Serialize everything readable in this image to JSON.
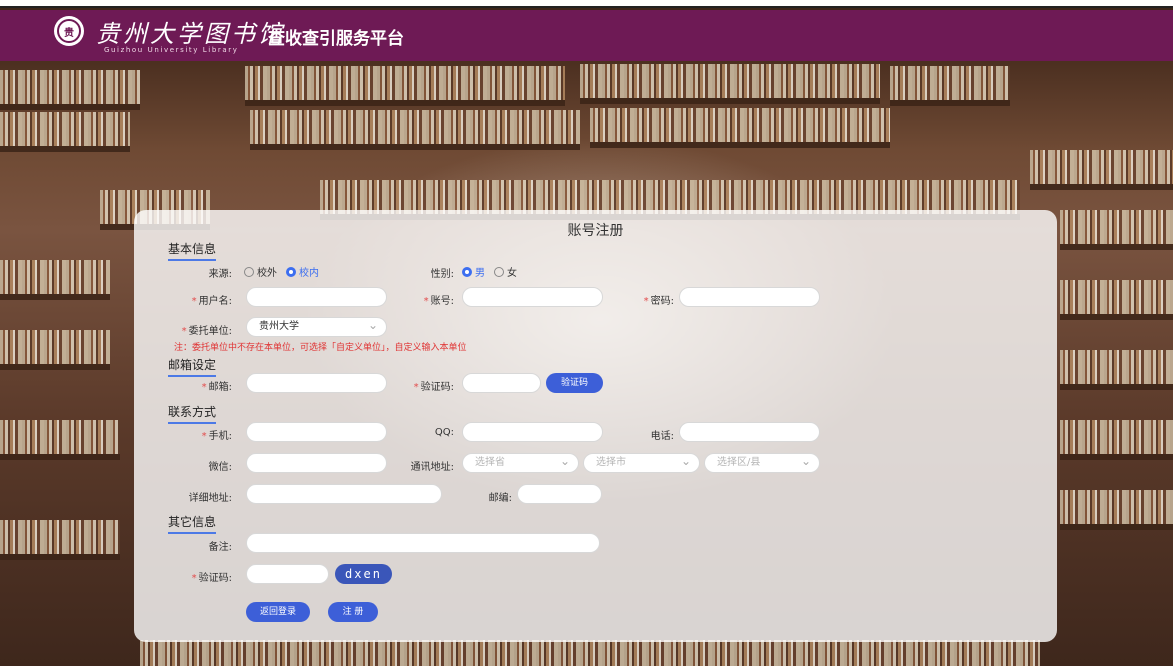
{
  "header": {
    "logo_seal": "贵",
    "logo_cn": "贵州大学图书馆",
    "logo_en": "Guizhou University Library",
    "platform_title": "查收查引服务平台"
  },
  "panel": {
    "title": "账号注册"
  },
  "basic": {
    "section_title": "基本信息",
    "source_label": "来源:",
    "source_options": [
      "校外",
      "校内"
    ],
    "source_selected": "校内",
    "gender_label": "性别:",
    "gender_options": [
      "男",
      "女"
    ],
    "gender_selected": "男",
    "username_label": "用户名:",
    "account_label": "账号:",
    "password_label": "密码:",
    "unit_label": "委托单位:",
    "unit_value": "贵州大学",
    "unit_note": "注：委托单位中不存在本单位，可选择「自定义单位」，自定义输入本单位"
  },
  "email": {
    "section_title": "邮箱设定",
    "email_label": "邮箱:",
    "code_label": "验证码:",
    "code_button": "验证码"
  },
  "contact": {
    "section_title": "联系方式",
    "phone_label": "手机:",
    "qq_label": "QQ:",
    "tel_label": "电话:",
    "wechat_label": "微信:",
    "address_label": "通讯地址:",
    "province_placeholder": "选择省",
    "city_placeholder": "选择市",
    "district_placeholder": "选择区/县",
    "detail_label": "详细地址:",
    "zip_label": "邮编:"
  },
  "other": {
    "section_title": "其它信息",
    "remark_label": "备注:",
    "captcha_label": "验证码:",
    "captcha_text": "dxen"
  },
  "actions": {
    "back_login": "返回登录",
    "register": "注 册"
  },
  "colors": {
    "header_bg": "#6e1a55",
    "accent": "#3d5fd8",
    "required": "#e24b4b"
  }
}
